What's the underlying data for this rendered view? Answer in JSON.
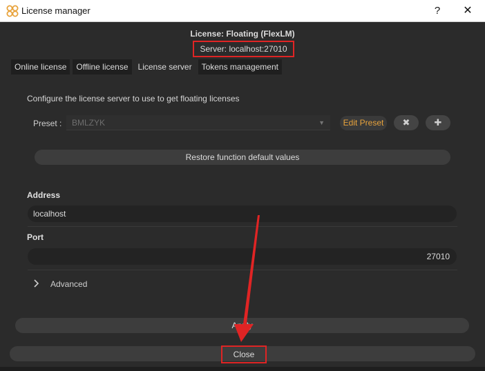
{
  "window": {
    "title": "License manager",
    "help_glyph": "?",
    "close_glyph": "✕"
  },
  "header": {
    "license_title": "License: Floating (FlexLM)",
    "server_line": "Server: localhost:27010"
  },
  "tabs": [
    {
      "label": "Online license",
      "active": false
    },
    {
      "label": "Offline license",
      "active": false
    },
    {
      "label": "License server",
      "active": true
    },
    {
      "label": "Tokens management",
      "active": false
    }
  ],
  "panel": {
    "description": "Configure the license server to use to get floating licenses",
    "preset": {
      "label": "Preset :",
      "value": "BMLZYK",
      "edit_label": "Edit Preset",
      "remove_glyph": "✖",
      "add_glyph": "✚"
    },
    "restore_label": "Restore function default values",
    "address": {
      "label": "Address",
      "value": "localhost"
    },
    "port": {
      "label": "Port",
      "value": "27010"
    },
    "advanced_label": "Advanced"
  },
  "footer": {
    "apply_label": "Apply",
    "close_label": "Close"
  },
  "colors": {
    "accent_orange": "#e8a33c",
    "highlight_red": "#e02424",
    "background": "#2b2b2b"
  },
  "icons": {
    "app": "app-logo-icon",
    "dropdown": "chevron-down-icon",
    "advanced": "chevron-right-icon"
  }
}
